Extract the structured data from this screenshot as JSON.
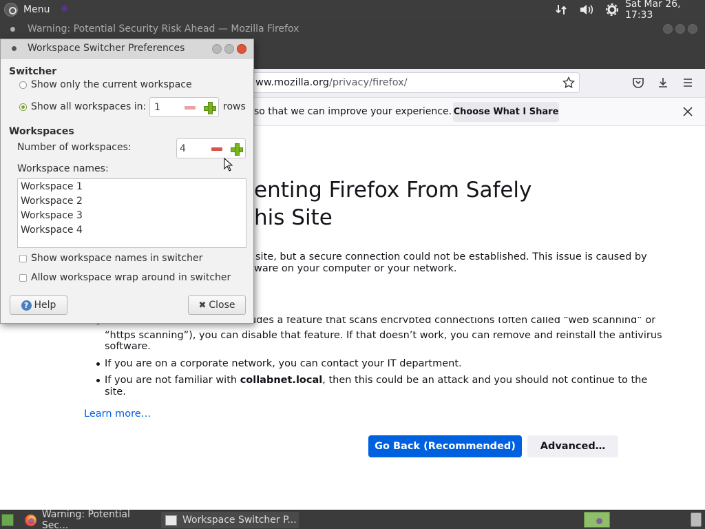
{
  "top_panel": {
    "menu_label": "Menu",
    "datetime": "Sat Mar 26, 17:33",
    "icons": [
      "network-icon",
      "volume-icon",
      "settings-gear-icon"
    ]
  },
  "firefox": {
    "window_title": "Warning: Potential Security Risk Ahead — Mozilla Firefox",
    "url_prefix": "ww.mozilla.org",
    "url_path": "/privacy/firefox/",
    "notification_text": "so that we can improve your experience.",
    "notification_button": "Choose What I Share",
    "error_title_line1": "enting Firefox From Safely",
    "error_title_line2": "his Site",
    "intro_line1": "site, but a secure connection could not be established. This issue is caused by",
    "intro_line2": "ware on your computer or your network.",
    "bullet1_top": "If your antivirus software includes a feature that scans encrypted connections (often called “web scanning” or",
    "bullet1_line2": "“https scanning”), you can disable that feature. If that doesn’t work, you can remove and reinstall the antivirus",
    "bullet1_line3": "software.",
    "bullet2": "If you are on a corporate network, you can contact your IT department.",
    "bullet3_pre": "If you are not familiar with ",
    "bullet3_bold": "collabnet.local",
    "bullet3_post": ", then this could be an attack and you should not continue to the",
    "bullet3_line2": "site.",
    "learn_more": "Learn more…",
    "go_back_button": "Go Back (Recommended)",
    "advanced_button": "Advanced…"
  },
  "dialog": {
    "title": "Workspace Switcher Preferences",
    "switcher_heading": "Switcher",
    "option_current": "Show only the current workspace",
    "option_all_prefix": "Show all workspaces in:",
    "rows_value": "1",
    "rows_suffix": "rows",
    "workspaces_heading": "Workspaces",
    "num_label": "Number of workspaces:",
    "num_value": "4",
    "names_label": "Workspace names:",
    "names": [
      "Workspace 1",
      "Workspace 2",
      "Workspace 3",
      "Workspace 4"
    ],
    "show_names_label": "Show workspace names in switcher",
    "wrap_label": "Allow workspace wrap around in switcher",
    "help_label": "Help",
    "close_label": "Close"
  },
  "taskbar": {
    "task1": "Warning: Potential Sec...",
    "task2": "Workspace Switcher P..."
  }
}
